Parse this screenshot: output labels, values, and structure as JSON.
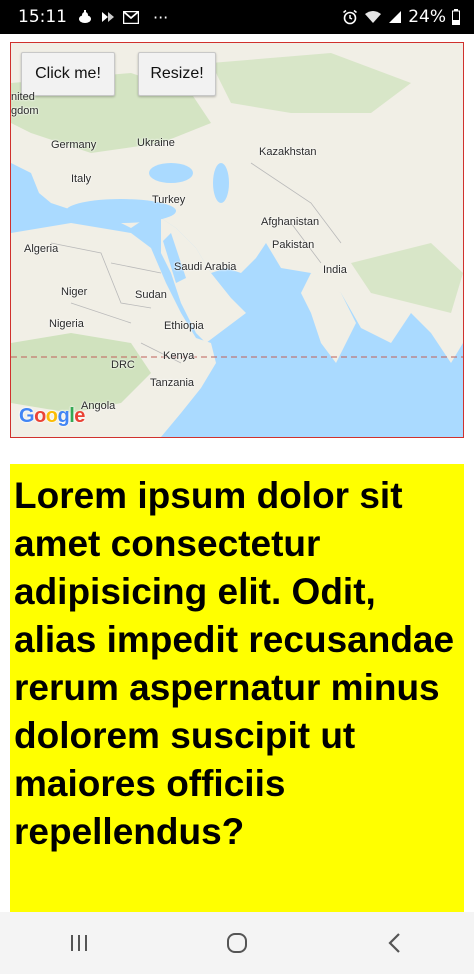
{
  "status_bar": {
    "time": "15:11",
    "battery": "24%",
    "more": "···",
    "icons_left": [
      "weather-icon",
      "app-notification-icon",
      "gmail-icon"
    ],
    "icons_right": [
      "alarm-icon",
      "wifi-icon",
      "signal-icon",
      "battery-icon"
    ]
  },
  "map": {
    "buttons": {
      "click_label": "Click me!",
      "resize_label": "Resize!"
    },
    "labels": {
      "united": "nited",
      "kingdom": "gdom",
      "germany": "Germany",
      "ukraine": "Ukraine",
      "kazakhstan": "Kazakhstan",
      "italy": "Italy",
      "turkey": "Turkey",
      "afghanistan": "Afghanistan",
      "pakistan": "Pakistan",
      "algeria": "Algeria",
      "saudi_arabia": "Saudi Arabia",
      "india": "India",
      "niger": "Niger",
      "sudan": "Sudan",
      "nigeria": "Nigeria",
      "ethiopia": "Ethiopia",
      "kenya": "Kenya",
      "drc": "DRC",
      "tanzania": "Tanzania",
      "angola": "Angola"
    },
    "attribution": {
      "g1": "G",
      "o1": "o",
      "o2": "o",
      "g2": "g",
      "l": "l",
      "e": "e"
    },
    "colors": {
      "water": "#aadaff",
      "land": "#f1efe6",
      "green": "#c8dfb4",
      "border_frame": "#d0312d"
    }
  },
  "content": {
    "lorem": "Lorem ipsum dolor sit amet consectetur adipisicing elit. Odit, alias impedit recusandae rerum aspernatur minus dolorem suscipit ut maiores officiis repellendus?",
    "background": "#ffff00"
  },
  "nav": {
    "icons": [
      "recent-apps-icon",
      "home-icon",
      "back-icon"
    ]
  }
}
